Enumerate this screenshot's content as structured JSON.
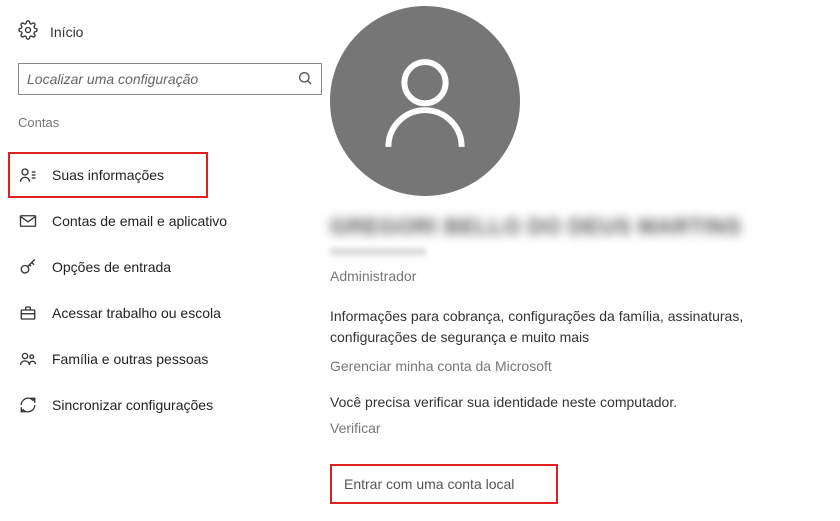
{
  "header": {
    "home_label": "Início"
  },
  "search": {
    "placeholder": "Localizar uma configuração"
  },
  "section": {
    "title": "Contas"
  },
  "sidebar": {
    "items": [
      {
        "label": "Suas informações"
      },
      {
        "label": "Contas de email e aplicativo"
      },
      {
        "label": "Opções de entrada"
      },
      {
        "label": "Acessar trabalho ou escola"
      },
      {
        "label": "Família e outras pessoas"
      },
      {
        "label": "Sincronizar configurações"
      }
    ]
  },
  "main": {
    "user_name": "GREGORI BELLO DO DEUS MARTINS",
    "user_sub": "xxxxxxxxxxxxxxxx",
    "role": "Administrador",
    "info_text": "Informações para cobrança, configurações da família, assinaturas, configurações de segurança e muito mais",
    "manage_link": "Gerenciar minha conta da Microsoft",
    "verify_prompt": "Você precisa verificar sua identidade neste computador.",
    "verify_link": "Verificar",
    "local_account": "Entrar com uma conta local"
  }
}
